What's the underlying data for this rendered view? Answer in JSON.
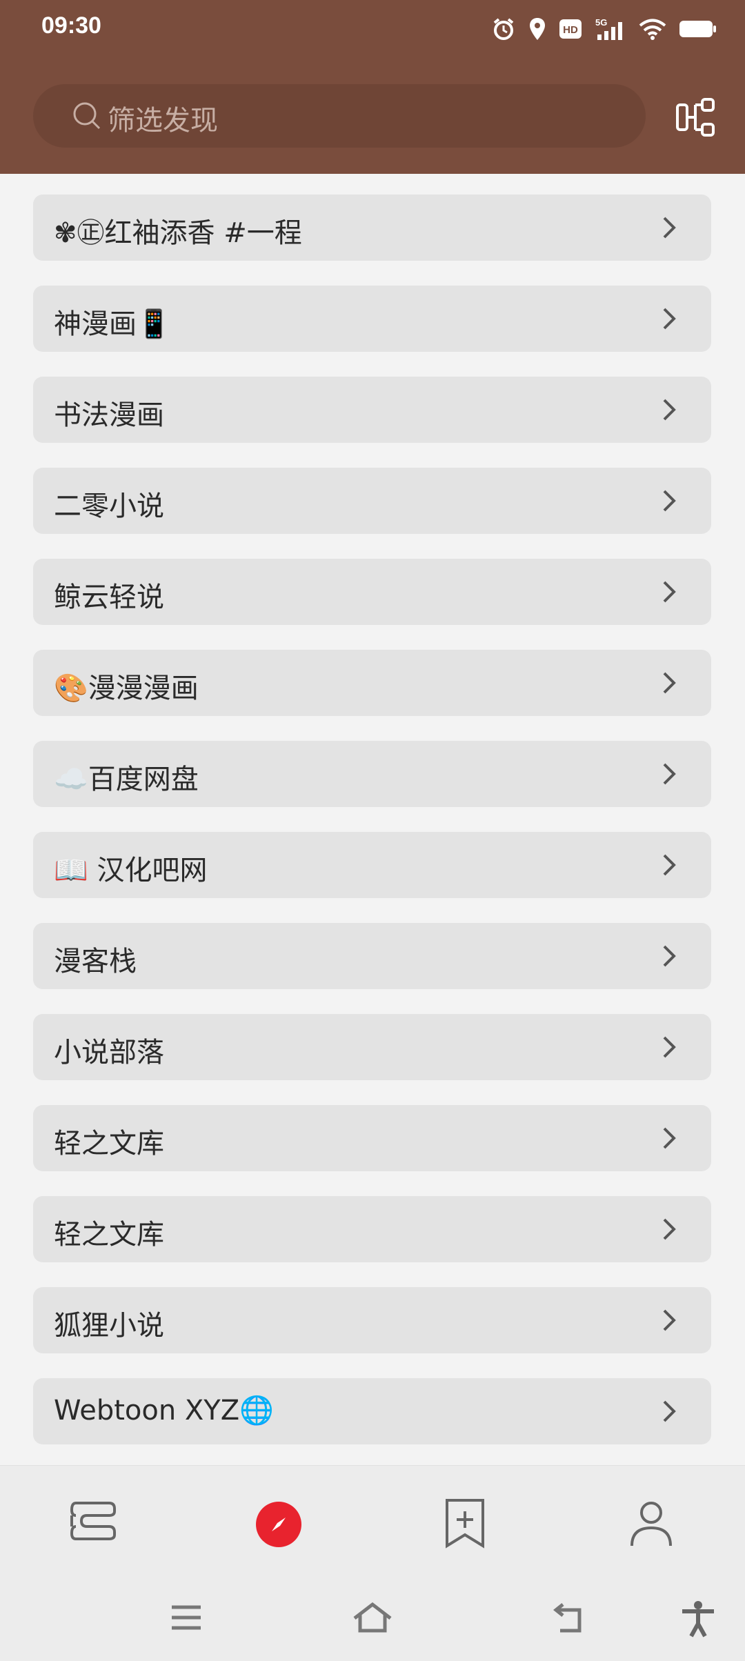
{
  "status": {
    "time": "09:30",
    "icons": [
      "alarm-icon",
      "location-icon",
      "hd-icon",
      "5g-signal-icon",
      "wifi-icon",
      "battery-icon"
    ]
  },
  "header": {
    "search_placeholder": "筛选发现",
    "share_icon": "share-tree-icon",
    "background": "#7a4d3d"
  },
  "sources": [
    {
      "label": "✾㊣红袖添香 #一程"
    },
    {
      "label": "神漫画📱"
    },
    {
      "label": "书法漫画"
    },
    {
      "label": "二零小说"
    },
    {
      "label": "鲸云轻说"
    },
    {
      "label": "🎨漫漫漫画"
    },
    {
      "label": "☁️百度网盘"
    },
    {
      "label": "📖 汉化吧网"
    },
    {
      "label": "漫客栈"
    },
    {
      "label": "小说部落"
    },
    {
      "label": "轻之文库"
    },
    {
      "label": "轻之文库"
    },
    {
      "label": "狐狸小说"
    },
    {
      "label": "Webtoon XYZ🌐"
    }
  ],
  "bottom_nav": {
    "items": [
      "bookshelf-icon",
      "explore-icon",
      "subscribe-icon",
      "profile-icon"
    ],
    "active": "explore-icon",
    "active_color": "#e8232e"
  },
  "system_nav": [
    "menu-icon",
    "home-icon",
    "back-icon",
    "accessibility-icon"
  ]
}
